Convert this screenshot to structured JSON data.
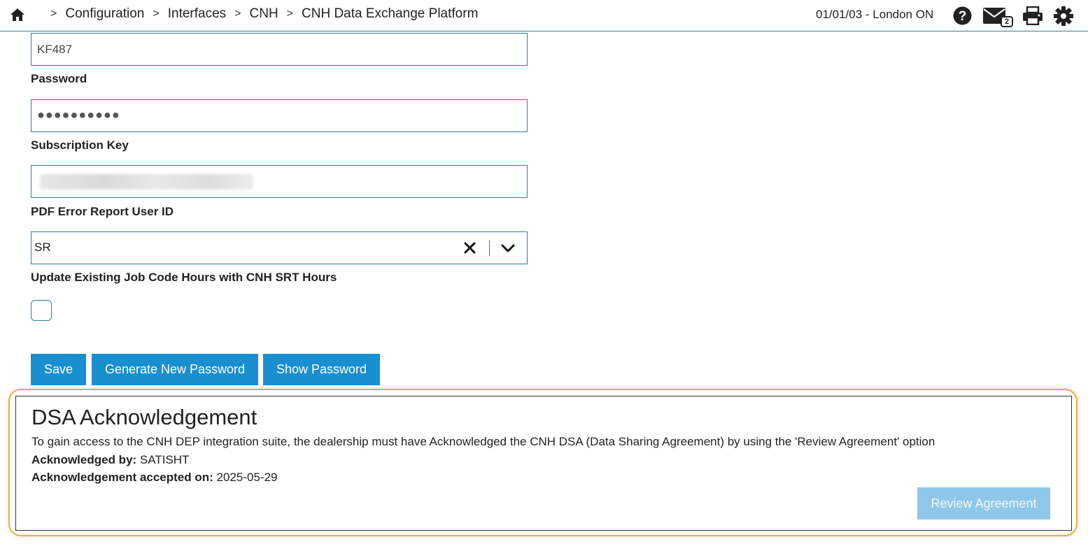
{
  "header": {
    "breadcrumbs": [
      "Configuration",
      "Interfaces",
      "CNH",
      "CNH Data Exchange Platform"
    ],
    "location": "01/01/03 - London ON",
    "mail_count": "2",
    "icons": [
      "home-icon",
      "help-icon",
      "mail-icon",
      "print-icon",
      "gear-icon"
    ]
  },
  "form": {
    "username": {
      "value": "KF487"
    },
    "password": {
      "label": "Password",
      "value": "●●●●●●●●●●"
    },
    "subscription_key": {
      "label": "Subscription Key"
    },
    "pdf_error_user": {
      "label": "PDF Error Report User ID",
      "value": "SR"
    },
    "update_hours": {
      "label": "Update Existing Job Code Hours with CNH SRT Hours",
      "checked": false
    }
  },
  "buttons": {
    "save": "Save",
    "generate_password": "Generate New Password",
    "show_password": "Show Password"
  },
  "dsa": {
    "title": "DSA Acknowledgement",
    "description": "To gain access to the CNH DEP integration suite, the dealership must have Acknowledged the CNH DSA (Data Sharing Agreement) by using the 'Review Agreement' option",
    "acknowledged_by_label": "Acknowledged by:",
    "acknowledged_by_value": "SATISHT",
    "accepted_on_label": "Acknowledgement accepted on:",
    "accepted_on_value": "2025-05-29",
    "review_button": "Review Agreement"
  },
  "colors": {
    "accent": "#1a8fd0",
    "field_border": "#2a7f93",
    "highlight": "#f0b030",
    "disabled_button": "#8fc7ea"
  }
}
